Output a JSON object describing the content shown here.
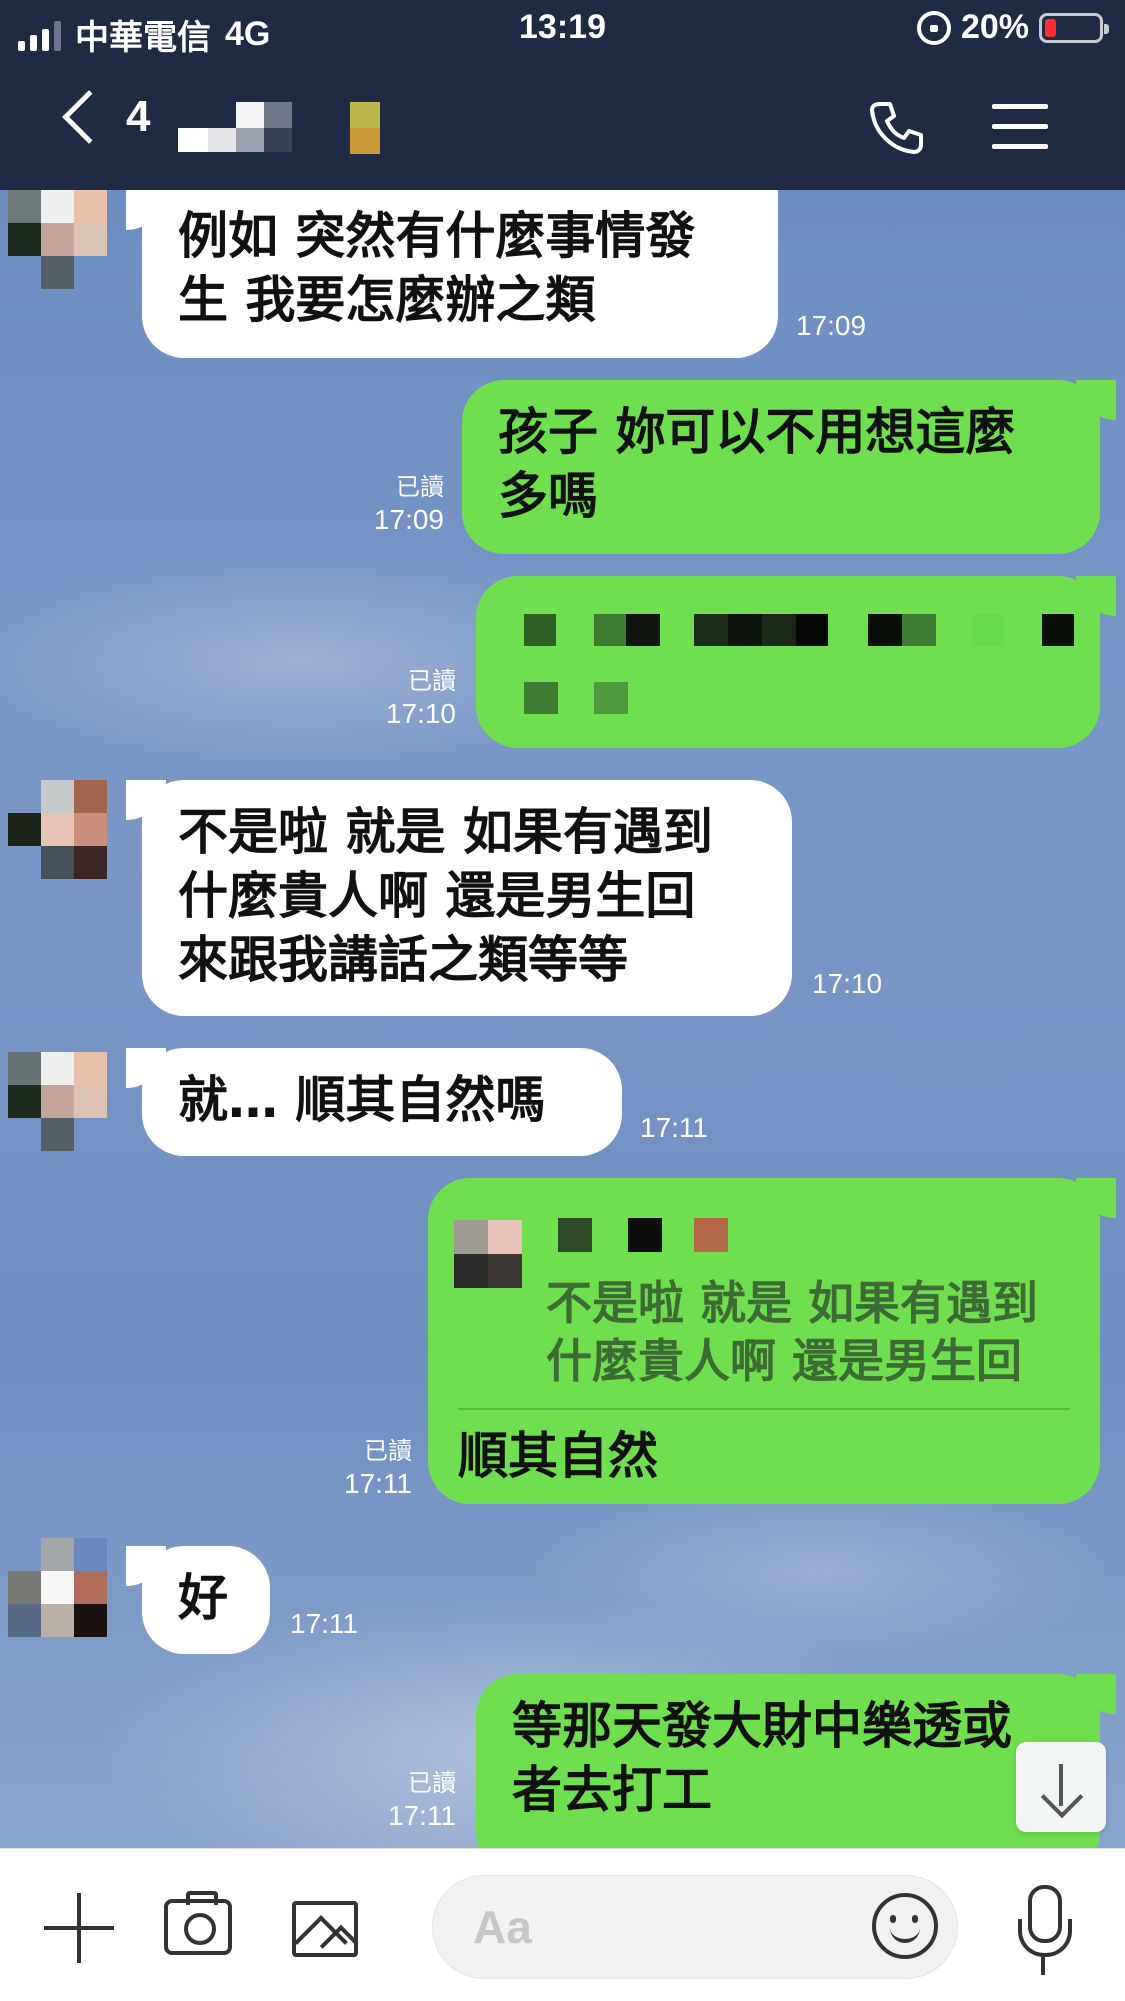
{
  "status_bar": {
    "carrier": "中華電信",
    "network": "4G",
    "time": "13:19",
    "battery": "20%"
  },
  "header": {
    "back_count": "4",
    "chat_name_censored": true,
    "icons": [
      "chevron-left-icon",
      "phone-icon",
      "menu-icon"
    ]
  },
  "messages": [
    {
      "side": "in",
      "text_lines": [
        "例如 突然有什麼事情發",
        "生 我要怎麼辦之類"
      ],
      "time": "17:09"
    },
    {
      "side": "out",
      "text_lines": [
        "孩子 妳可以不用想這麼",
        "多嗎"
      ],
      "read": "已讀",
      "time": "17:09"
    },
    {
      "side": "out",
      "censored": true,
      "read": "已讀",
      "time": "17:10"
    },
    {
      "side": "in",
      "text_lines": [
        "不是啦 就是 如果有遇到",
        "什麼貴人啊 還是男生回",
        "來跟我講話之類等等"
      ],
      "time": "17:10"
    },
    {
      "side": "in",
      "text_lines": [
        "就… 順其自然嗎"
      ],
      "time": "17:11"
    },
    {
      "side": "out",
      "reply_quote_lines": [
        "不是啦 就是 如果有遇到",
        "什麼貴人啊 還是男生回"
      ],
      "text_lines": [
        "順其自然"
      ],
      "read": "已讀",
      "time": "17:11"
    },
    {
      "side": "in",
      "text_lines": [
        "好"
      ],
      "time": "17:11"
    },
    {
      "side": "out",
      "text_lines": [
        "等那天發大財中樂透或",
        "者去打工"
      ],
      "read": "已讀",
      "time": "17:11"
    }
  ],
  "input_bar": {
    "placeholder": "Aa",
    "icons": [
      "plus-icon",
      "camera-icon",
      "image-icon",
      "emoji-icon",
      "mic-icon"
    ]
  },
  "colors": {
    "header_bg": "#1f2a44",
    "outgoing_bubble": "#6fdf50",
    "incoming_bubble": "#ffffff",
    "chat_bg": "#6f8fc2"
  }
}
